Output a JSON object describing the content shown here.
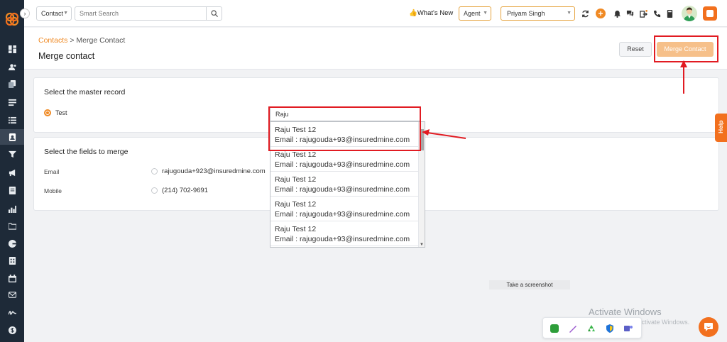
{
  "topbar": {
    "entity_select": "Contact",
    "search_placeholder": "Smart Search",
    "whats_new": "What's New",
    "role_select": "Agent",
    "user_select": "Priyam Singh"
  },
  "page": {
    "breadcrumb_link": "Contacts",
    "breadcrumb_sep": " > ",
    "breadcrumb_current": "Merge Contact",
    "title": "Merge contact",
    "reset_label": "Reset",
    "merge_label": "Merge Contact"
  },
  "master": {
    "title": "Select the master record",
    "option_label": "Test"
  },
  "fields": {
    "title": "Select the fields to merge",
    "rows": [
      {
        "label": "Email",
        "value": "rajugouda+923@insuredmine.com"
      },
      {
        "label": "Mobile",
        "value": "(214) 702-9691"
      }
    ]
  },
  "dropdown": {
    "search_value": "Raju",
    "items": [
      {
        "name": "Raju Test 12",
        "email": "Email : rajugouda+93@insuredmine.com"
      },
      {
        "name": "Raju Test 12",
        "email": "Email : rajugouda+93@insuredmine.com"
      },
      {
        "name": "Raju Test 12",
        "email": "Email : rajugouda+93@insuredmine.com"
      },
      {
        "name": "Raju Test 12",
        "email": "Email : rajugouda+93@insuredmine.com"
      },
      {
        "name": "Raju Test 12",
        "email": "Email : rajugouda+93@insuredmine.com"
      }
    ]
  },
  "help_label": "Help",
  "screenshot_tip": "Take a screenshot",
  "activate_title": "Activate Windows",
  "activate_sub": "Go to Settings to activate Windows.",
  "colors": {
    "accent": "#f08a24",
    "highlight": "#e11b22",
    "sidebar": "#1e2a38"
  },
  "icons": {
    "sidebar": [
      "dashboard-icon",
      "contacts-icon",
      "copy-icon",
      "list-icon",
      "contact-card-icon",
      "filter-icon",
      "megaphone-icon",
      "document-icon",
      "chart-icon",
      "folder-icon",
      "google-icon",
      "spreadsheet-icon",
      "calendar-icon",
      "mail-icon",
      "signature-icon",
      "dollar-icon"
    ]
  }
}
